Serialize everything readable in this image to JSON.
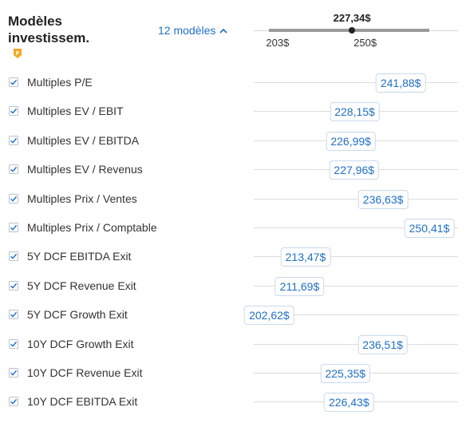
{
  "header": {
    "title": "Modèles investissem.",
    "count_label": "12 modèles",
    "icon": "chevron-up-icon",
    "pro_icon": "pro-badge-icon",
    "accent_color": "#1f6fc5",
    "pro_color": "#f5a623"
  },
  "range": {
    "current": "227,34$",
    "min_label": "203$",
    "max_label": "250$",
    "current_value": 227.34,
    "min_value": 202.62,
    "max_value": 250.41
  },
  "models": [
    {
      "label": "Multiples P/E",
      "value": "241,88$",
      "num": 241.88,
      "checked": true
    },
    {
      "label": "Multiples EV / EBIT",
      "value": "228,15$",
      "num": 228.15,
      "checked": true
    },
    {
      "label": "Multiples EV / EBITDA",
      "value": "226,99$",
      "num": 226.99,
      "checked": true
    },
    {
      "label": "Multiples EV / Revenus",
      "value": "227,96$",
      "num": 227.96,
      "checked": true
    },
    {
      "label": "Multiples Prix / Ventes",
      "value": "236,63$",
      "num": 236.63,
      "checked": true
    },
    {
      "label": "Multiples Prix / Comptable",
      "value": "250,41$",
      "num": 250.41,
      "checked": true
    },
    {
      "label": "5Y DCF EBITDA Exit",
      "value": "213,47$",
      "num": 213.47,
      "checked": true
    },
    {
      "label": "5Y DCF Revenue Exit",
      "value": "211,69$",
      "num": 211.69,
      "checked": true
    },
    {
      "label": "5Y DCF Growth Exit",
      "value": "202,62$",
      "num": 202.62,
      "checked": true
    },
    {
      "label": "10Y DCF Growth Exit",
      "value": "236,51$",
      "num": 236.51,
      "checked": true
    },
    {
      "label": "10Y DCF Revenue Exit",
      "value": "225,35$",
      "num": 225.35,
      "checked": true
    },
    {
      "label": "10Y DCF EBITDA Exit",
      "value": "226,43$",
      "num": 226.43,
      "checked": true
    }
  ]
}
